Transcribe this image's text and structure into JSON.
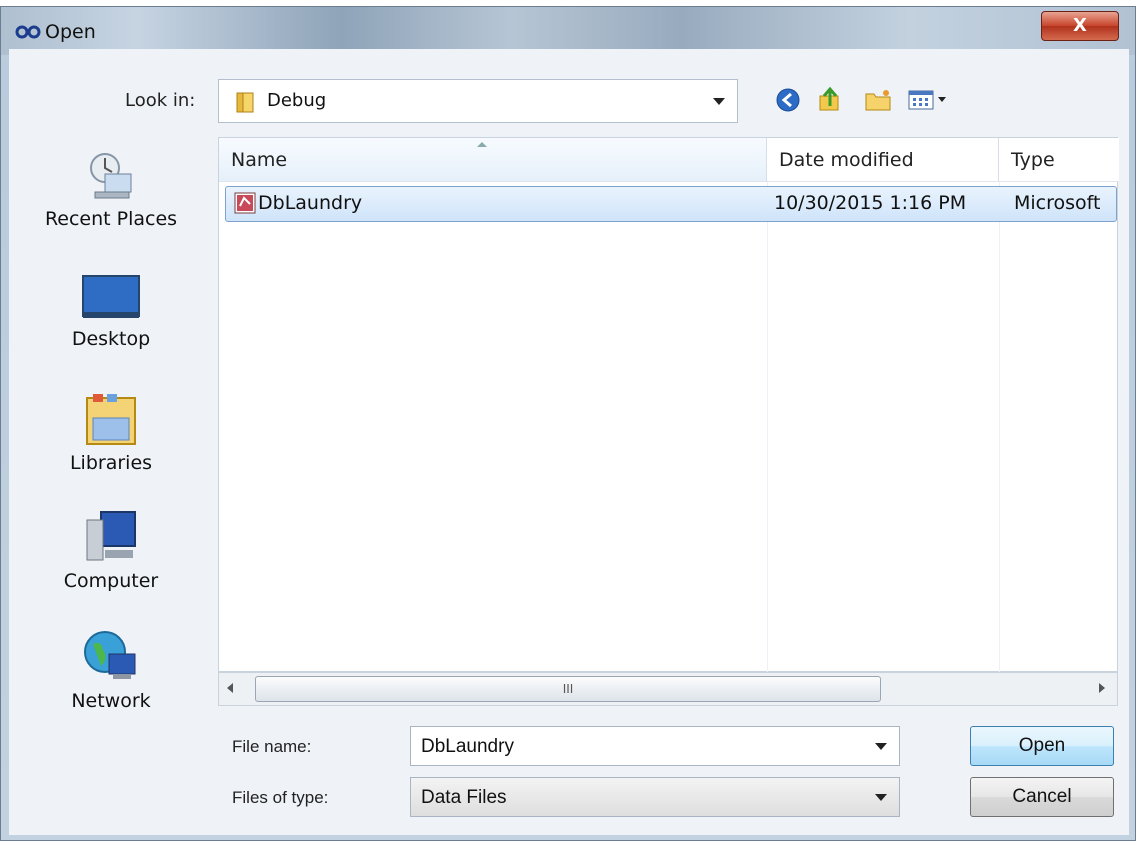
{
  "window": {
    "title": "Open",
    "close_glyph": "X"
  },
  "top_strip_text": "",
  "toolbar": {
    "look_in_label": "Look in:",
    "look_in_value": "Debug",
    "icons": [
      "back-icon",
      "up-folder-icon",
      "new-folder-icon",
      "view-menu-icon"
    ]
  },
  "places": [
    {
      "label": "Recent Places",
      "icon": "recent-places-icon"
    },
    {
      "label": "Desktop",
      "icon": "desktop-icon"
    },
    {
      "label": "Libraries",
      "icon": "libraries-icon"
    },
    {
      "label": "Computer",
      "icon": "computer-icon"
    },
    {
      "label": "Network",
      "icon": "network-icon"
    }
  ],
  "columns": {
    "name": "Name",
    "date": "Date modified",
    "type": "Type"
  },
  "files": [
    {
      "name": "DbLaundry",
      "date": "10/30/2015 1:16 PM",
      "type": "Microsoft"
    }
  ],
  "scrollbar": {
    "thumb_grip": "III"
  },
  "file_name": {
    "label": "File name:",
    "value": "DbLaundry"
  },
  "file_type": {
    "label": "Files of type:",
    "value": "Data Files"
  },
  "buttons": {
    "open": "Open",
    "cancel": "Cancel"
  },
  "colors": {
    "titlebar": "#aebfd0",
    "selection": "#cfe4fa",
    "close": "#c7432a"
  }
}
